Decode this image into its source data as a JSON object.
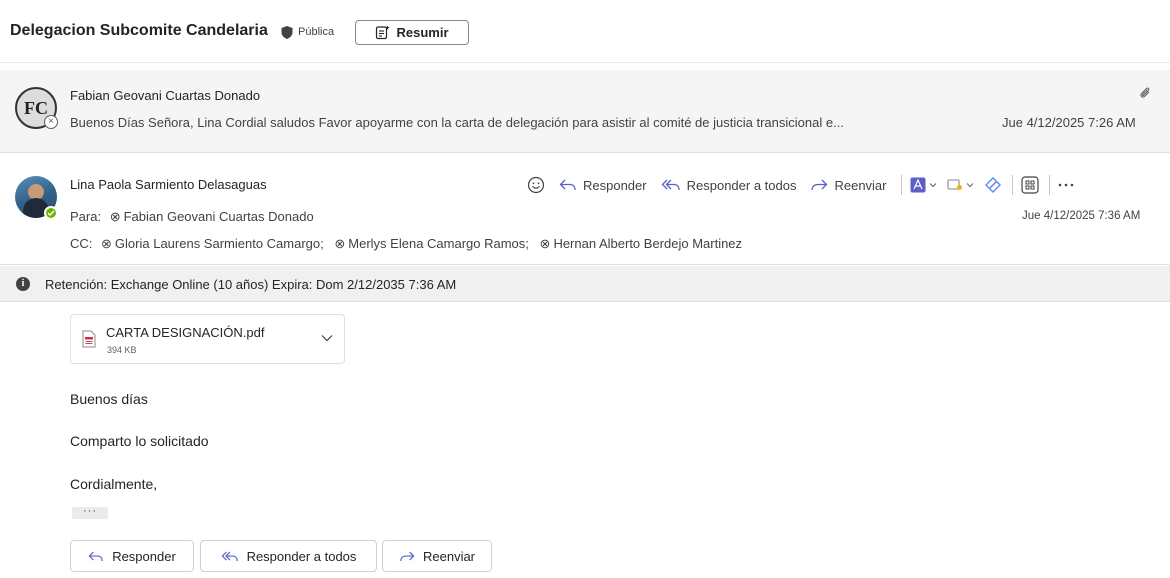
{
  "header": {
    "subject": "Delegacion Subcomite Candelaria",
    "visibility": "Pública",
    "summarize_label": "Resumir"
  },
  "collapsed_message": {
    "sender": "Fabian Geovani Cuartas Donado",
    "avatar_initials": "FC",
    "preview": "Buenos Días Señora, Lina Cordial saludos Favor apoyarme con la carta de delegación para asistir al comité de justicia transicional e...",
    "date": "Jue 4/12/2025 7:26 AM",
    "icon": "paperclip-icon"
  },
  "expanded_message": {
    "sender": "Lina Paola Sarmiento Delasaguas",
    "to_label": "Para:",
    "to": "Fabian Geovani Cuartas Donado",
    "cc_label": "CC:",
    "cc": [
      "Gloria Laurens Sarmiento Camargo;",
      "Merlys Elena Camargo Ramos;",
      "Hernan Alberto Berdejo Martinez"
    ],
    "date": "Jue 4/12/2025 7:36 AM",
    "toolbar": {
      "reply": "Responder",
      "reply_all": "Responder a todos",
      "forward": "Reenviar"
    }
  },
  "retention": {
    "text": "Retención: Exchange Online (10 años) Expira: Dom 2/12/2035 7:36 AM"
  },
  "attachment": {
    "name": "CARTA DESIGNACIÓN.pdf",
    "size": "394 KB"
  },
  "body": {
    "lines": [
      "Buenos días",
      "Comparto lo solicitado",
      "Cordialmente,"
    ],
    "more": "···"
  },
  "footer_buttons": {
    "reply": "Responder",
    "reply_all": "Responder a todos",
    "forward": "Reenviar"
  },
  "colors": {
    "accent": "#5b5fc7",
    "presence": "#6bb700",
    "pdf": "#c4314b"
  }
}
